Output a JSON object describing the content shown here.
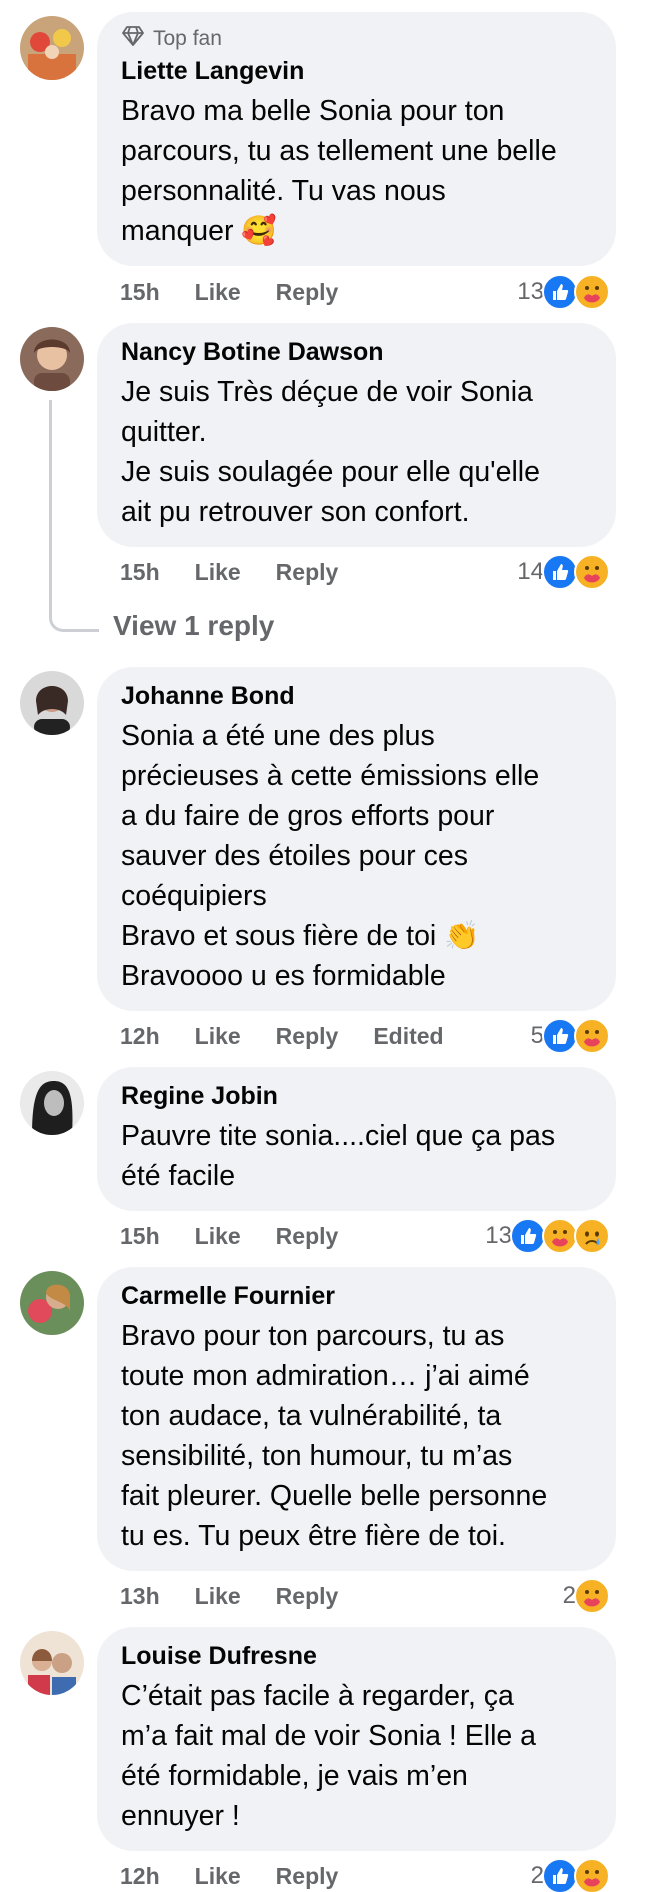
{
  "comments": [
    {
      "top_fan": "Top fan",
      "author": "Liette Langevin",
      "lines": [
        "Bravo ma belle Sonia pour ton",
        "parcours, tu as tellement une belle",
        "personnalité. Tu vas nous",
        "manquer 🥰"
      ],
      "time": "15h",
      "like": "Like",
      "reply": "Reply",
      "edited": "",
      "reaction_count": "13",
      "reactions": [
        "like-icon",
        "care-icon"
      ]
    },
    {
      "author": "Nancy Botine Dawson",
      "lines": [
        "Je suis Très déçue de voir Sonia",
        "quitter.",
        "Je suis soulagée pour elle qu'elle",
        "ait pu retrouver son confort."
      ],
      "time": "15h",
      "like": "Like",
      "reply": "Reply",
      "edited": "",
      "reaction_count": "14",
      "reactions": [
        "like-icon",
        "care-icon"
      ],
      "view_replies": "View 1 reply"
    },
    {
      "author": "Johanne Bond",
      "lines": [
        "Sonia a été une des plus",
        "précieuses à cette émissions elle",
        "a du faire de gros efforts pour",
        "sauver des étoiles pour ces",
        "coéquipiers",
        "Bravo et sous fière de toi 👏",
        "Bravoooo u es formidable"
      ],
      "time": "12h",
      "like": "Like",
      "reply": "Reply",
      "edited": "Edited",
      "reaction_count": "5",
      "reactions": [
        "like-icon",
        "care-icon"
      ]
    },
    {
      "author": "Regine Jobin",
      "lines": [
        "Pauvre tite sonia....ciel que ça pas",
        "été facile"
      ],
      "time": "15h",
      "like": "Like",
      "reply": "Reply",
      "edited": "",
      "reaction_count": "13",
      "reactions": [
        "like-icon",
        "care-icon",
        "sad-icon"
      ]
    },
    {
      "author": "Carmelle Fournier",
      "lines": [
        "Bravo pour ton parcours, tu as",
        "toute mon admiration… j’ai aimé",
        "ton audace, ta vulnérabilité, ta",
        "sensibilité, ton humour, tu m’as",
        "fait pleurer. Quelle belle personne",
        "tu es. Tu peux être fière de toi."
      ],
      "time": "13h",
      "like": "Like",
      "reply": "Reply",
      "edited": "",
      "reaction_count": "2",
      "reactions": [
        "care-icon"
      ]
    },
    {
      "author": "Louise Dufresne",
      "lines": [
        "C’était pas facile à regarder, ça",
        "m’a fait mal de voir Sonia ! Elle a",
        "été formidable, je vais m’en",
        "ennuyer !"
      ],
      "time": "12h",
      "like": "Like",
      "reply": "Reply",
      "edited": "",
      "reaction_count": "2",
      "reactions": [
        "like-icon",
        "care-icon"
      ]
    }
  ],
  "colors": {
    "bubble": "#f0f2f5",
    "meta_text": "#65676b",
    "like_blue": "#1877f2",
    "care_yellow": "#f7b125",
    "thread_line": "#ccd0d5"
  }
}
